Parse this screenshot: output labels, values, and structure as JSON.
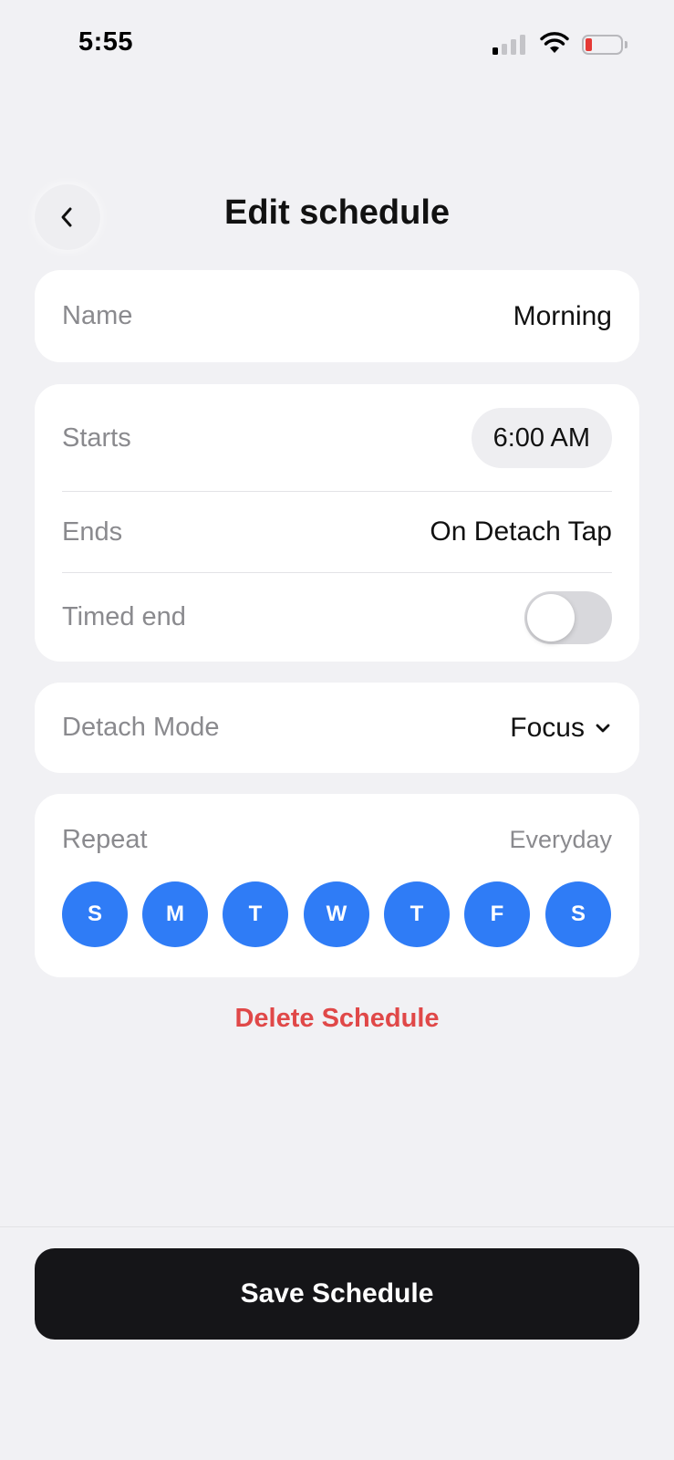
{
  "status_bar": {
    "time": "5:55",
    "signal_bars_active": 1,
    "signal_bars_total": 4,
    "battery_level": 0.1
  },
  "header": {
    "title": "Edit schedule",
    "back_icon": "chevron-left-icon"
  },
  "name_card": {
    "label": "Name",
    "value": "Morning"
  },
  "time_card": {
    "starts_label": "Starts",
    "starts_value": "6:00 AM",
    "ends_label": "Ends",
    "ends_value": "On Detach Tap",
    "timed_end_label": "Timed end",
    "timed_end_on": false
  },
  "mode_card": {
    "label": "Detach Mode",
    "value": "Focus",
    "icon": "chevron-down-icon"
  },
  "repeat_card": {
    "label": "Repeat",
    "summary": "Everyday",
    "days": [
      {
        "letter": "S",
        "selected": true
      },
      {
        "letter": "M",
        "selected": true
      },
      {
        "letter": "T",
        "selected": true
      },
      {
        "letter": "W",
        "selected": true
      },
      {
        "letter": "T",
        "selected": true
      },
      {
        "letter": "F",
        "selected": true
      },
      {
        "letter": "S",
        "selected": true
      }
    ]
  },
  "delete_label": "Delete Schedule",
  "save_label": "Save Schedule",
  "colors": {
    "accent": "#2f7cf6",
    "danger": "#e04848",
    "background": "#f1f1f4",
    "button": "#151518"
  }
}
